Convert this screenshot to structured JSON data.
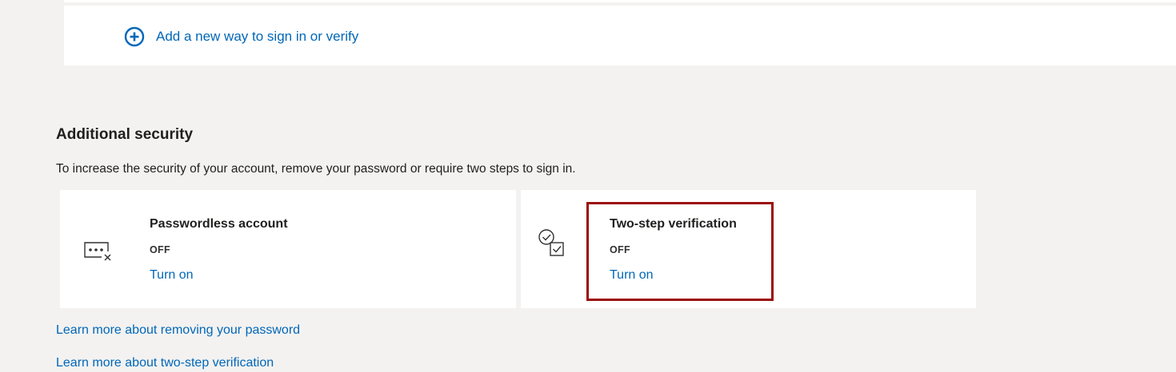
{
  "add_method": {
    "label": "Add a new way to sign in or verify",
    "icon": "plus-circle-icon"
  },
  "additional_security": {
    "title": "Additional security",
    "description": "To increase the security of your account, remove your password or require two steps to sign in.",
    "cards": [
      {
        "title": "Passwordless account",
        "status": "OFF",
        "action": "Turn on",
        "icon": "password-removed-icon"
      },
      {
        "title": "Two-step verification",
        "status": "OFF",
        "action": "Turn on",
        "icon": "two-step-check-icon"
      }
    ],
    "links": [
      "Learn more about removing your password",
      "Learn more about two-step verification"
    ]
  },
  "colors": {
    "link": "#0067b8",
    "background": "#f3f2f1",
    "highlight": "#9b0b0b"
  }
}
